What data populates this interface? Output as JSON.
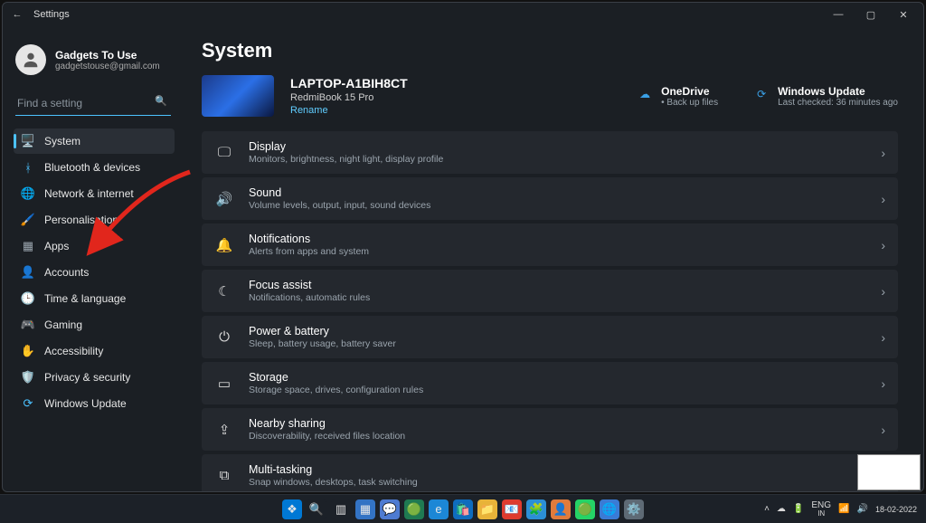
{
  "window": {
    "title": "Settings",
    "min": "—",
    "max": "▢",
    "close": "✕",
    "back": "←"
  },
  "profile": {
    "name": "Gadgets To Use",
    "email": "gadgetstouse@gmail.com"
  },
  "search": {
    "placeholder": "Find a setting"
  },
  "nav": [
    {
      "icon": "🖥️",
      "label": "System",
      "active": true,
      "color": "#4cc2ff"
    },
    {
      "icon": "ᚼ",
      "label": "Bluetooth & devices",
      "color": "#4cc2ff"
    },
    {
      "icon": "🌐",
      "label": "Network & internet",
      "color": "#8ad1ff"
    },
    {
      "icon": "🖌️",
      "label": "Personalisation",
      "color": "#d9a24a"
    },
    {
      "icon": "▦",
      "label": "Apps",
      "color": "#9aa4ad"
    },
    {
      "icon": "👤",
      "label": "Accounts",
      "color": "#e0a96d"
    },
    {
      "icon": "🕒",
      "label": "Time & language",
      "color": "#9aa4ad"
    },
    {
      "icon": "🎮",
      "label": "Gaming",
      "color": "#9aa4ad"
    },
    {
      "icon": "✋",
      "label": "Accessibility",
      "color": "#6fc2ff"
    },
    {
      "icon": "🛡️",
      "label": "Privacy & security",
      "color": "#9aa4ad"
    },
    {
      "icon": "⟳",
      "label": "Windows Update",
      "color": "#4cc2ff"
    }
  ],
  "page": {
    "heading": "System",
    "device": {
      "name": "LAPTOP-A1BIH8CT",
      "model": "RedmiBook 15 Pro",
      "rename": "Rename"
    },
    "onedrive": {
      "title": "OneDrive",
      "sub": "Back up files"
    },
    "update": {
      "title": "Windows Update",
      "sub": "Last checked: 36 minutes ago"
    },
    "items": [
      {
        "icon": "🖵",
        "title": "Display",
        "desc": "Monitors, brightness, night light, display profile"
      },
      {
        "icon": "🔊",
        "title": "Sound",
        "desc": "Volume levels, output, input, sound devices"
      },
      {
        "icon": "🔔",
        "title": "Notifications",
        "desc": "Alerts from apps and system"
      },
      {
        "icon": "☾",
        "title": "Focus assist",
        "desc": "Notifications, automatic rules"
      },
      {
        "icon": "⏻",
        "title": "Power & battery",
        "desc": "Sleep, battery usage, battery saver"
      },
      {
        "icon": "▭",
        "title": "Storage",
        "desc": "Storage space, drives, configuration rules"
      },
      {
        "icon": "⇪",
        "title": "Nearby sharing",
        "desc": "Discoverability, received files location"
      },
      {
        "icon": "⧉",
        "title": "Multi-tasking",
        "desc": "Snap windows, desktops, task switching"
      }
    ]
  },
  "taskbar": {
    "icons": [
      {
        "bg": "#0078d4",
        "glyph": "❖"
      },
      {
        "bg": "#1c2128",
        "glyph": "🔍"
      },
      {
        "bg": "#1c2128",
        "glyph": "▥"
      },
      {
        "bg": "#3373c4",
        "glyph": "▦"
      },
      {
        "bg": "#4e7bd1",
        "glyph": "💬"
      },
      {
        "bg": "#1f7a52",
        "glyph": "🟢"
      },
      {
        "bg": "#1c87d6",
        "glyph": "e"
      },
      {
        "bg": "#0f6cbd",
        "glyph": "🛍️"
      },
      {
        "bg": "#e8b339",
        "glyph": "📁"
      },
      {
        "bg": "#de3b2f",
        "glyph": "📧"
      },
      {
        "bg": "#2b8fd6",
        "glyph": "🧩"
      },
      {
        "bg": "#e07b3c",
        "glyph": "👤"
      },
      {
        "bg": "#25d366",
        "glyph": "🟢"
      },
      {
        "bg": "#3a7bd5",
        "glyph": "🌐"
      },
      {
        "bg": "#5e6a75",
        "glyph": "⚙️"
      }
    ],
    "lang1": "ENG",
    "lang2": "IN",
    "wifi": "📶",
    "vol": "🔊",
    "date": "18-02-2022"
  }
}
